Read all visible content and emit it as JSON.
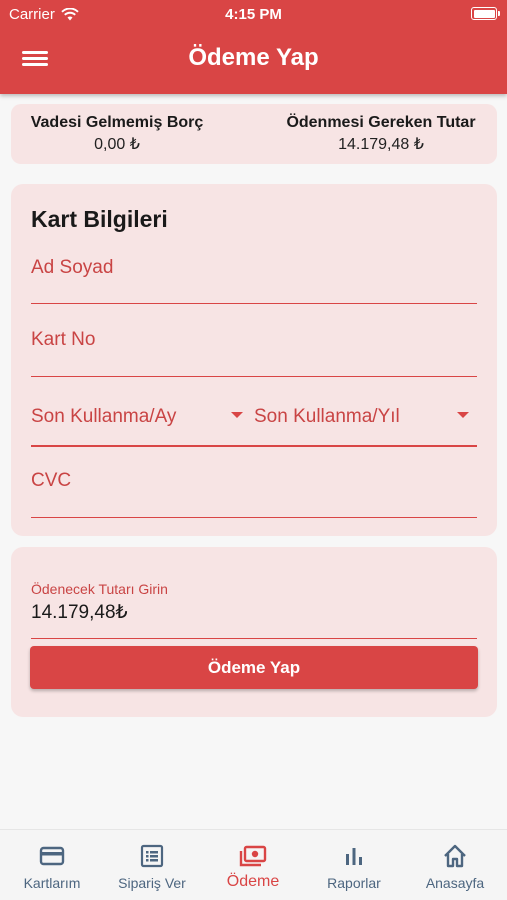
{
  "status_bar": {
    "carrier": "Carrier",
    "time": "4:15 PM"
  },
  "header": {
    "title": "Ödeme Yap",
    "menu_icon": "menu-icon"
  },
  "summary": {
    "left_label": "Vadesi Gelmemiş Borç",
    "left_value": "0,00 ₺",
    "right_label": "Ödenmesi Gereken Tutar",
    "right_value": "14.179,48 ₺"
  },
  "card_form": {
    "title": "Kart Bilgileri",
    "name_placeholder": "Ad Soyad",
    "card_no_placeholder": "Kart No",
    "expiry_month_placeholder": "Son Kullanma/Ay",
    "expiry_year_placeholder": "Son Kullanma/Yıl",
    "cvc_placeholder": "CVC"
  },
  "payment": {
    "amount_label": "Ödenecek Tutarı Girin",
    "amount_value": "14.179,48₺",
    "submit_label": "Ödeme Yap"
  },
  "bottom_nav": {
    "items": [
      {
        "label": "Kartlarım",
        "icon": "credit-card-icon"
      },
      {
        "label": "Sipariş Ver",
        "icon": "list-icon"
      },
      {
        "label": "Ödeme",
        "icon": "payment-icon",
        "active": true
      },
      {
        "label": "Raporlar",
        "icon": "bar-chart-icon"
      },
      {
        "label": "Anasayfa",
        "icon": "home-icon"
      }
    ]
  },
  "colors": {
    "primary": "#d94545",
    "card_bg": "#f7e4e4",
    "nav_inactive": "#4d6680"
  }
}
